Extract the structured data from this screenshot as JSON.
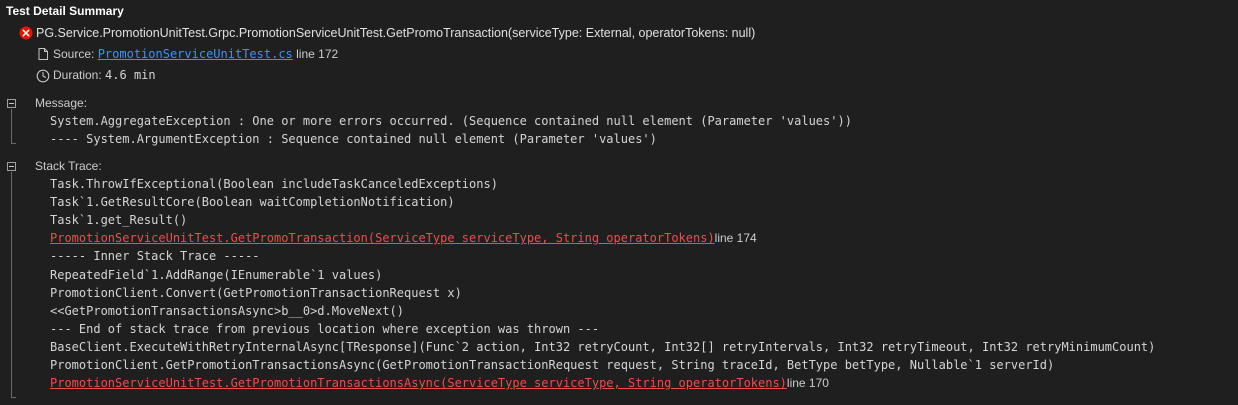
{
  "panel": {
    "title": "Test Detail Summary"
  },
  "test": {
    "status_icon": "error-circle-icon",
    "name": "PG.Service.PromotionUnitTest.Grpc.PromotionServiceUnitTest.GetPromoTransaction(serviceType: External, operatorTokens: null)",
    "source_label": "Source:",
    "source_file": "PromotionServiceUnitTest.cs",
    "source_line": "line 172",
    "duration_label": "Duration:",
    "duration_value": "4.6 min"
  },
  "message": {
    "label": "Message:",
    "lines": [
      "System.AggregateException : One or more errors occurred. (Sequence contained null element (Parameter 'values'))",
      "---- System.ArgumentException : Sequence contained null element (Parameter 'values')"
    ]
  },
  "stack": {
    "label": "Stack Trace:",
    "lines": [
      {
        "text": "Task.ThrowIfExceptional(Boolean includeTaskCanceledExceptions)",
        "link": false,
        "suffix": ""
      },
      {
        "text": "Task`1.GetResultCore(Boolean waitCompletionNotification)",
        "link": false,
        "suffix": ""
      },
      {
        "text": "Task`1.get_Result()",
        "link": false,
        "suffix": ""
      },
      {
        "text": "PromotionServiceUnitTest.GetPromoTransaction(ServiceType serviceType, String operatorTokens)",
        "link": true,
        "suffix": "line 174"
      },
      {
        "text": "----- Inner Stack Trace -----",
        "link": false,
        "suffix": ""
      },
      {
        "text": "RepeatedField`1.AddRange(IEnumerable`1 values)",
        "link": false,
        "suffix": ""
      },
      {
        "text": "PromotionClient.Convert(GetPromotionTransactionRequest x)",
        "link": false,
        "suffix": ""
      },
      {
        "text": "<<GetPromotionTransactionsAsync>b__0>d.MoveNext()",
        "link": false,
        "suffix": ""
      },
      {
        "text": "--- End of stack trace from previous location where exception was thrown ---",
        "link": false,
        "suffix": ""
      },
      {
        "text": "BaseClient.ExecuteWithRetryInternalAsync[TResponse](Func`2 action, Int32 retryCount, Int32[] retryIntervals, Int32 retryTimeout, Int32 retryMinimumCount)",
        "link": false,
        "suffix": ""
      },
      {
        "text": "PromotionClient.GetPromotionTransactionsAsync(GetPromotionTransactionRequest request, String traceId, BetType betType, Nullable`1 serverId)",
        "link": false,
        "suffix": ""
      },
      {
        "text": "PromotionServiceUnitTest.GetPromotionTransactionsAsync(ServiceType serviceType, String operatorTokens)",
        "link": true,
        "suffix": "line 170"
      }
    ]
  },
  "colors": {
    "background": "#1f1f1f",
    "error": "#e51400",
    "link_blue": "#3794ff",
    "link_red": "#f14c4c"
  }
}
